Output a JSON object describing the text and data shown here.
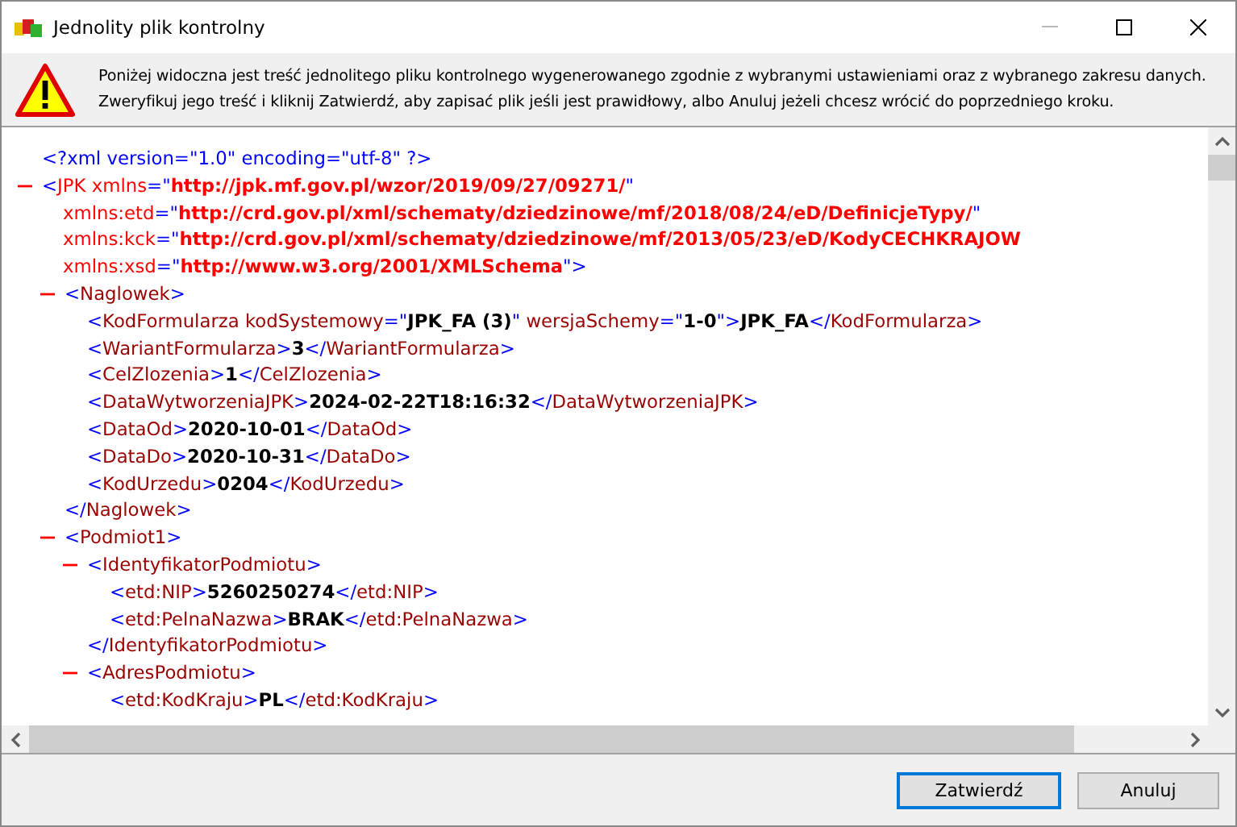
{
  "window": {
    "title": "Jednolity plik kontrolny"
  },
  "message": "Poniżej widoczna jest treść jednolitego pliku kontrolnego wygenerowanego zgodnie z wybranymi ustawieniami oraz z wybranego zakresu danych. Zweryfikuj jego treść i kliknij Zatwierdź, aby zapisać plik jeśli jest prawidłowy, albo Anuluj jeżeli chcesz wrócić do poprzedniego kroku.",
  "xml": [
    {
      "lines": [
        [
          {
            "kind": "p",
            "text": "<?xml version=\"1.0\" encoding=\"utf-8\" ?>"
          }
        ]
      ]
    },
    {
      "expanded": true,
      "lines": [
        [
          {
            "kind": "p",
            "text": "<"
          },
          {
            "kind": "a",
            "text": "JPK xmlns"
          },
          {
            "kind": "p",
            "text": "=\""
          },
          {
            "kind": "s",
            "text": "http://jpk.mf.gov.pl/wzor/2019/09/27/09271/"
          },
          {
            "kind": "p",
            "text": "\""
          }
        ],
        [
          {
            "kind": "a",
            "text": "xmlns:etd"
          },
          {
            "kind": "p",
            "text": "=\""
          },
          {
            "kind": "s",
            "text": "http://crd.gov.pl/xml/schematy/dziedzinowe/mf/2018/08/24/eD/DefinicjeTypy/"
          },
          {
            "kind": "p",
            "text": "\""
          }
        ],
        [
          {
            "kind": "a",
            "text": "xmlns:kck"
          },
          {
            "kind": "p",
            "text": "=\""
          },
          {
            "kind": "s",
            "text": "http://crd.gov.pl/xml/schematy/dziedzinowe/mf/2013/05/23/eD/KodyCECHKRAJOW"
          }
        ],
        [
          {
            "kind": "a",
            "text": "xmlns:xsd"
          },
          {
            "kind": "p",
            "text": "=\""
          },
          {
            "kind": "s",
            "text": "http://www.w3.org/2001/XMLSchema"
          },
          {
            "kind": "p",
            "text": "\">"
          }
        ]
      ],
      "children": [
        {
          "expanded": true,
          "lines": [
            [
              {
                "kind": "p",
                "text": "<"
              },
              {
                "kind": "n",
                "text": "Naglowek"
              },
              {
                "kind": "p",
                "text": ">"
              }
            ]
          ],
          "children": [
            {
              "lines": [
                [
                  {
                    "kind": "p",
                    "text": "<"
                  },
                  {
                    "kind": "n",
                    "text": "KodFormularza kodSystemowy"
                  },
                  {
                    "kind": "p",
                    "text": "=\""
                  },
                  {
                    "kind": "t",
                    "text": "JPK_FA (3)"
                  },
                  {
                    "kind": "p",
                    "text": "\""
                  },
                  {
                    "kind": "n",
                    "text": " wersjaSchemy"
                  },
                  {
                    "kind": "p",
                    "text": "=\""
                  },
                  {
                    "kind": "t",
                    "text": "1-0"
                  },
                  {
                    "kind": "p",
                    "text": "\">"
                  },
                  {
                    "kind": "t",
                    "text": "JPK_FA"
                  },
                  {
                    "kind": "p",
                    "text": "</"
                  },
                  {
                    "kind": "n",
                    "text": "KodFormularza"
                  },
                  {
                    "kind": "p",
                    "text": ">"
                  }
                ]
              ]
            },
            {
              "lines": [
                [
                  {
                    "kind": "p",
                    "text": "<"
                  },
                  {
                    "kind": "n",
                    "text": "WariantFormularza"
                  },
                  {
                    "kind": "p",
                    "text": ">"
                  },
                  {
                    "kind": "t",
                    "text": "3"
                  },
                  {
                    "kind": "p",
                    "text": "</"
                  },
                  {
                    "kind": "n",
                    "text": "WariantFormularza"
                  },
                  {
                    "kind": "p",
                    "text": ">"
                  }
                ]
              ]
            },
            {
              "lines": [
                [
                  {
                    "kind": "p",
                    "text": "<"
                  },
                  {
                    "kind": "n",
                    "text": "CelZlozenia"
                  },
                  {
                    "kind": "p",
                    "text": ">"
                  },
                  {
                    "kind": "t",
                    "text": "1"
                  },
                  {
                    "kind": "p",
                    "text": "</"
                  },
                  {
                    "kind": "n",
                    "text": "CelZlozenia"
                  },
                  {
                    "kind": "p",
                    "text": ">"
                  }
                ]
              ]
            },
            {
              "lines": [
                [
                  {
                    "kind": "p",
                    "text": "<"
                  },
                  {
                    "kind": "n",
                    "text": "DataWytworzeniaJPK"
                  },
                  {
                    "kind": "p",
                    "text": ">"
                  },
                  {
                    "kind": "t",
                    "text": "2024-02-22T18:16:32"
                  },
                  {
                    "kind": "p",
                    "text": "</"
                  },
                  {
                    "kind": "n",
                    "text": "DataWytworzeniaJPK"
                  },
                  {
                    "kind": "p",
                    "text": ">"
                  }
                ]
              ]
            },
            {
              "lines": [
                [
                  {
                    "kind": "p",
                    "text": "<"
                  },
                  {
                    "kind": "n",
                    "text": "DataOd"
                  },
                  {
                    "kind": "p",
                    "text": ">"
                  },
                  {
                    "kind": "t",
                    "text": "2020-10-01"
                  },
                  {
                    "kind": "p",
                    "text": "</"
                  },
                  {
                    "kind": "n",
                    "text": "DataOd"
                  },
                  {
                    "kind": "p",
                    "text": ">"
                  }
                ]
              ]
            },
            {
              "lines": [
                [
                  {
                    "kind": "p",
                    "text": "<"
                  },
                  {
                    "kind": "n",
                    "text": "DataDo"
                  },
                  {
                    "kind": "p",
                    "text": ">"
                  },
                  {
                    "kind": "t",
                    "text": "2020-10-31"
                  },
                  {
                    "kind": "p",
                    "text": "</"
                  },
                  {
                    "kind": "n",
                    "text": "DataDo"
                  },
                  {
                    "kind": "p",
                    "text": ">"
                  }
                ]
              ]
            },
            {
              "lines": [
                [
                  {
                    "kind": "p",
                    "text": "<"
                  },
                  {
                    "kind": "n",
                    "text": "KodUrzedu"
                  },
                  {
                    "kind": "p",
                    "text": ">"
                  },
                  {
                    "kind": "t",
                    "text": "0204"
                  },
                  {
                    "kind": "p",
                    "text": "</"
                  },
                  {
                    "kind": "n",
                    "text": "KodUrzedu"
                  },
                  {
                    "kind": "p",
                    "text": ">"
                  }
                ]
              ]
            }
          ],
          "close": [
            {
              "kind": "p",
              "text": "</"
            },
            {
              "kind": "n",
              "text": "Naglowek"
            },
            {
              "kind": "p",
              "text": ">"
            }
          ]
        },
        {
          "expanded": true,
          "lines": [
            [
              {
                "kind": "p",
                "text": "<"
              },
              {
                "kind": "n",
                "text": "Podmiot1"
              },
              {
                "kind": "p",
                "text": ">"
              }
            ]
          ],
          "children": [
            {
              "expanded": true,
              "lines": [
                [
                  {
                    "kind": "p",
                    "text": "<"
                  },
                  {
                    "kind": "n",
                    "text": "IdentyfikatorPodmiotu"
                  },
                  {
                    "kind": "p",
                    "text": ">"
                  }
                ]
              ],
              "children": [
                {
                  "lines": [
                    [
                      {
                        "kind": "p",
                        "text": "<"
                      },
                      {
                        "kind": "n",
                        "text": "etd:NIP"
                      },
                      {
                        "kind": "p",
                        "text": ">"
                      },
                      {
                        "kind": "t",
                        "text": "5260250274"
                      },
                      {
                        "kind": "p",
                        "text": "</"
                      },
                      {
                        "kind": "n",
                        "text": "etd:NIP"
                      },
                      {
                        "kind": "p",
                        "text": ">"
                      }
                    ]
                  ]
                },
                {
                  "lines": [
                    [
                      {
                        "kind": "p",
                        "text": "<"
                      },
                      {
                        "kind": "n",
                        "text": "etd:PelnaNazwa"
                      },
                      {
                        "kind": "p",
                        "text": ">"
                      },
                      {
                        "kind": "t",
                        "text": "BRAK"
                      },
                      {
                        "kind": "p",
                        "text": "</"
                      },
                      {
                        "kind": "n",
                        "text": "etd:PelnaNazwa"
                      },
                      {
                        "kind": "p",
                        "text": ">"
                      }
                    ]
                  ]
                }
              ],
              "close": [
                {
                  "kind": "p",
                  "text": "</"
                },
                {
                  "kind": "n",
                  "text": "IdentyfikatorPodmiotu"
                },
                {
                  "kind": "p",
                  "text": ">"
                }
              ]
            },
            {
              "expanded": true,
              "lines": [
                [
                  {
                    "kind": "p",
                    "text": "<"
                  },
                  {
                    "kind": "n",
                    "text": "AdresPodmiotu"
                  },
                  {
                    "kind": "p",
                    "text": ">"
                  }
                ]
              ],
              "children": [
                {
                  "lines": [
                    [
                      {
                        "kind": "p",
                        "text": "<"
                      },
                      {
                        "kind": "n",
                        "text": "etd:KodKraju"
                      },
                      {
                        "kind": "p",
                        "text": ">"
                      },
                      {
                        "kind": "t",
                        "text": "PL"
                      },
                      {
                        "kind": "p",
                        "text": "</"
                      },
                      {
                        "kind": "n",
                        "text": "etd:KodKraju"
                      },
                      {
                        "kind": "p",
                        "text": ">"
                      }
                    ]
                  ]
                }
              ]
            }
          ]
        }
      ]
    }
  ],
  "buttons": [
    {
      "label": "Zatwierdź",
      "default": true
    },
    {
      "label": "Anuluj",
      "default": false
    }
  ]
}
